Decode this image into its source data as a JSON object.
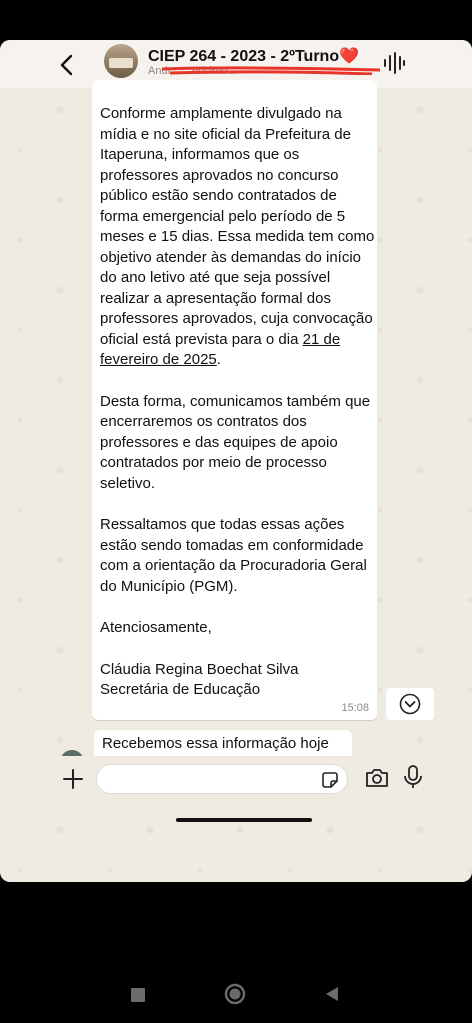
{
  "chat": {
    "title": "CIEP 264 - 2023 - 2ºTurno❤️",
    "subtitle": "Andr... ...ericimo..."
  },
  "message": {
    "paragraphs": [
      "Conforme amplamente divulgado na mídia e no site oficial da Prefeitura de Itaperuna, informamos que os professores aprovados no concurso público estão sendo contratados de forma emergencial pelo período de 5 meses e 15 dias. Essa medida tem como objetivo atender às demandas do início do ano letivo até que seja possível realizar a apresentação formal dos professores aprovados, cuja convocação oficial está prevista para o dia ",
      "Desta forma, comunicamos também que encerraremos os contratos dos professores e das equipes de apoio contratados por meio de processo seletivo.",
      "Ressaltamos que todas essas ações estão sendo tomadas em conformidade com a orientação da Procuradoria Geral do Município (PGM).",
      "Atenciosamente,"
    ],
    "date_link": "21 de fevereiro de 2025",
    "date_suffix": ".",
    "signature_name": "Cláudia Regina Boechat Silva",
    "signature_role": "Secretária de Educação",
    "time": "15:08"
  },
  "next_message": {
    "text": "Recebemos essa informação hoje"
  },
  "composer": {
    "placeholder": ""
  },
  "icons": {
    "back": "arrow-left-icon",
    "voice_call": "audio-wave-icon",
    "scroll_down": "chevron-down-icon",
    "attach": "plus-icon",
    "sticker": "sticker-icon",
    "camera": "camera-icon",
    "mic": "mic-icon"
  }
}
